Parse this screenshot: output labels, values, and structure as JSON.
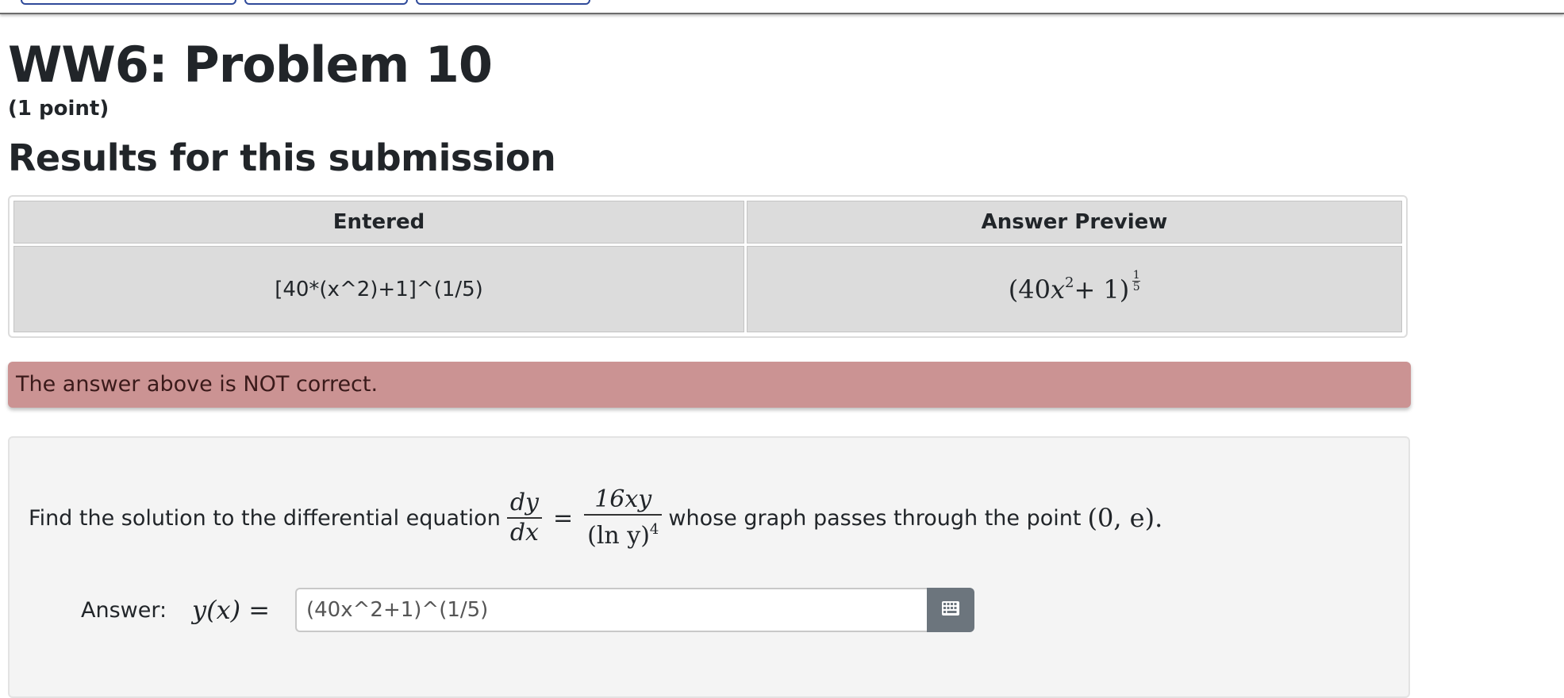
{
  "page": {
    "title": "WW6: Problem 10",
    "points": "(1 point)"
  },
  "results": {
    "heading": "Results for this submission",
    "columns": [
      "Entered",
      "Answer Preview"
    ],
    "rows": [
      {
        "entered": "[40*(x^2)+1]^(1/5)",
        "preview": "(40x² + 1)^(1/5)"
      }
    ],
    "preview_parts": {
      "base": "(40",
      "var": "x",
      "sq": "2",
      "rest": " + 1)",
      "exp_num": "1",
      "exp_den": "5"
    }
  },
  "alert": {
    "message": "The answer above is NOT correct.",
    "color": "#cb9393"
  },
  "problem": {
    "text_before": "Find the solution to the differential equation",
    "frac1_num": "dy",
    "frac1_den": "dx",
    "equals": "=",
    "frac2_num": "16xy",
    "frac2_den_main": "(ln y)",
    "frac2_den_exp": "4",
    "text_after": "whose graph passes through the point",
    "point": "(0, e).",
    "answer_label": "Answer:",
    "answer_lhs": "y(x) =",
    "answer_value": "(40x^2+1)^(1/5)",
    "keyboard_icon": "calculator-grid-icon"
  }
}
